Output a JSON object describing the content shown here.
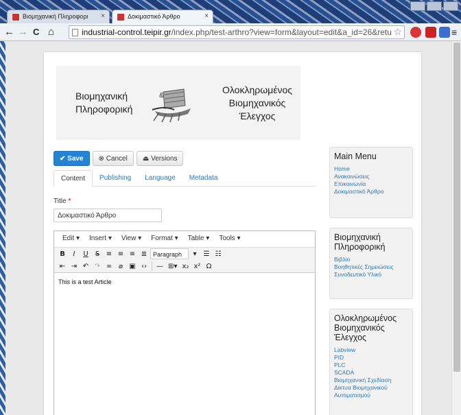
{
  "browser": {
    "tabs": [
      {
        "label": "Βιομηχανική Πληροφορι",
        "close": "×",
        "icon": "favicon-icon"
      },
      {
        "label": "Δοκιμαστικό Άρθρο",
        "close": "×",
        "icon": "favicon-icon"
      }
    ],
    "url": {
      "host": "industrial-control.teipir.gr",
      "path": "/index.php/test-arthro?view=form&layout=edit&a_id=26&retu"
    },
    "nav": {
      "back": "←",
      "forward": "→",
      "reload": "C",
      "home": "⌂",
      "star": "☆",
      "menu": "≡"
    }
  },
  "logo": {
    "left_line1": "Βιομηχανική",
    "left_line2": "Πληροφορική",
    "amp": "&",
    "right_line1": "Ολοκληρωμένος",
    "right_line2": "Βιομηχανικός",
    "right_line3": "Έλεγχος"
  },
  "actions": {
    "save": "Save",
    "cancel": "Cancel",
    "versions": "Versions"
  },
  "form_tabs": [
    "Content",
    "Publishing",
    "Language",
    "Metadata"
  ],
  "title_field": {
    "label": "Title",
    "required": "*",
    "value": "Δοκιμαστικό Άρθρο"
  },
  "editor": {
    "menus": [
      "Edit ▾",
      "Insert ▾",
      "View ▾",
      "Format ▾",
      "Table ▾",
      "Tools ▾"
    ],
    "paragraph_select": "Paragraph",
    "body": "This is a test Article"
  },
  "sidebar": {
    "main_menu": {
      "title": "Main Menu",
      "items": [
        "Home",
        "Ανακοινώσεις",
        "Επικοινωνία",
        "Δοκιμαστικό Άρθρο"
      ]
    },
    "info": {
      "title_line1": "Βιομηχανική",
      "title_line2": "Πληροφορική",
      "items": [
        "Βιβλίο",
        "Βοηθητικές Σημειώσεις",
        "Συνοδευτικό Υλικό"
      ]
    },
    "control": {
      "title_line1": "Ολοκληρωμένος",
      "title_line2": "Βιομηχανικός",
      "title_line3": "Έλεγχος",
      "items": [
        "Labview",
        "PID",
        "PLC",
        "SCADA",
        "Βιομηχανική Σχεδίαση",
        "Δίκτυα Βιομηχανικού",
        "Αυτοματισμού"
      ]
    }
  },
  "colors": {
    "primary": "#2384d3",
    "link": "#2a7ab8"
  }
}
